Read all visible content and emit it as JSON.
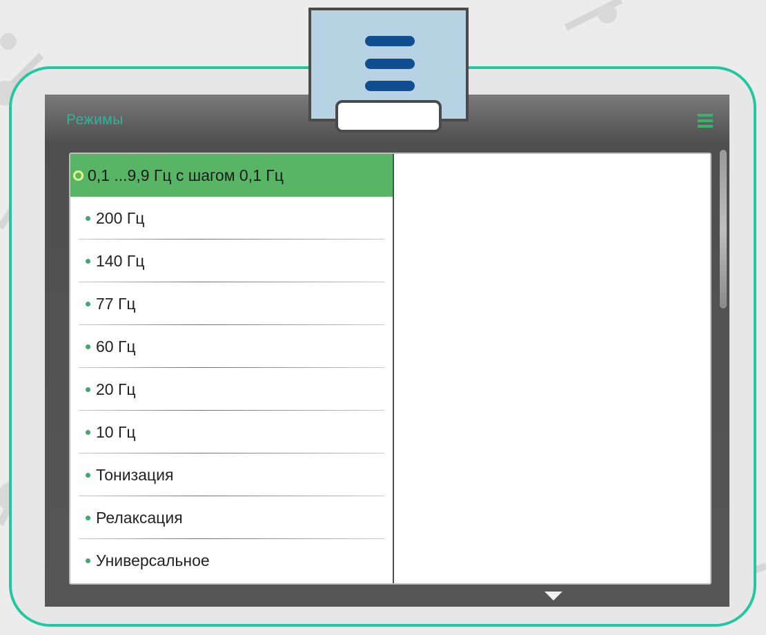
{
  "panel": {
    "title": "Режимы"
  },
  "modes": {
    "items": [
      {
        "label": "0,1 ...9,9 Гц с шагом 0,1 Гц",
        "selected": true
      },
      {
        "label": "200 Гц",
        "selected": false
      },
      {
        "label": "140 Гц",
        "selected": false
      },
      {
        "label": "77 Гц",
        "selected": false
      },
      {
        "label": "60 Гц",
        "selected": false
      },
      {
        "label": "20 Гц",
        "selected": false
      },
      {
        "label": "10 Гц",
        "selected": false
      },
      {
        "label": "Тонизация",
        "selected": false
      },
      {
        "label": "Релаксация",
        "selected": false
      },
      {
        "label": "Универсальное",
        "selected": false
      }
    ]
  },
  "icons": {
    "menu_badge": "hamburger-menu-icon",
    "header_menu": "hamburger-menu-icon",
    "scroll_down": "triangle-down-icon",
    "bullet": "dot-icon",
    "selected_bullet": "ring-icon"
  },
  "colors": {
    "frame_border": "#21c7a0",
    "title": "#2fb59a",
    "selected_row": "#58b565",
    "bullet": "#3caa6a",
    "menu_badge_bg": "#b7d3e3",
    "menu_bars": "#104e92"
  }
}
